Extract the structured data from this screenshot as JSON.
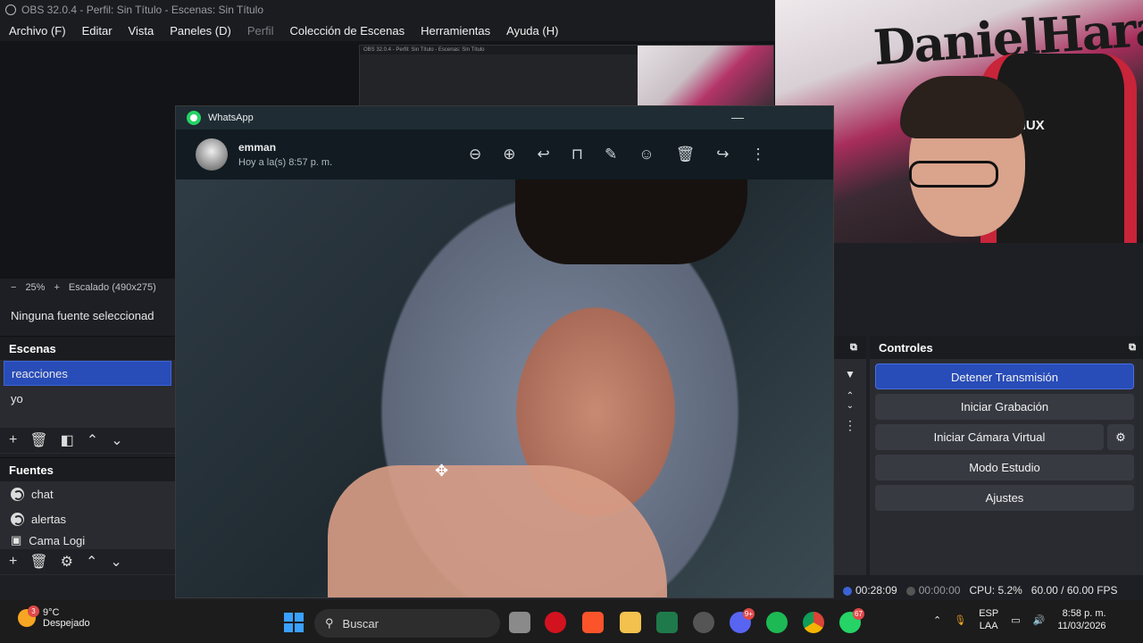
{
  "obs": {
    "title": "OBS 32.0.4 - Perfil: Sin Título - Escenas: Sin Título",
    "menu": [
      "Archivo (F)",
      "Editar",
      "Vista",
      "Paneles (D)",
      "Perfil",
      "Colección de Escenas",
      "Herramientas",
      "Ayuda (H)"
    ],
    "zoom": {
      "minus": "−",
      "value": "25%",
      "plus": "+",
      "scaling": "Escalado (490x275)"
    },
    "no_source": "Ninguna fuente seleccionad",
    "scenes": {
      "title": "Escenas",
      "items": [
        "reacciones",
        "yo"
      ],
      "active_index": 0
    },
    "sources": {
      "title": "Fuentes",
      "items": [
        "chat",
        "alertas",
        "Cama Logi"
      ]
    },
    "controls": {
      "title": "Controles",
      "buttons": [
        "Detener Transmisión",
        "Iniciar Grabación",
        "Iniciar Cámara Virtual",
        "Modo Estudio",
        "Ajustes"
      ]
    },
    "status": {
      "stream_time": "00:28:09",
      "record_time": "00:00:00",
      "cpu": "CPU: 5.2%",
      "fps": "60.00 / 60.00 FPS"
    },
    "mini_preview_text": "OBS 32.0.4 - Perfil: Sin Título - Escenas: Sin Título"
  },
  "webcam": {
    "graffiti_text": "DanielHara",
    "chair_text": "NUX"
  },
  "whatsapp": {
    "window_title": "WhatsApp",
    "contact_name": "emman",
    "timestamp": "Hoy a la(s) 8:57 p. m.",
    "tool_icons": [
      "zoom-out",
      "zoom-in",
      "reply",
      "bookmark",
      "pin",
      "emoji",
      "delete",
      "forward",
      "more"
    ]
  },
  "taskbar": {
    "weather_temp": "9°C",
    "weather_desc": "Despejado",
    "weather_badge": "3",
    "search_placeholder": "Buscar",
    "discord_badge": "9+",
    "whatsapp_badge": "67",
    "lang_top": "ESP",
    "lang_bottom": "LAA",
    "time": "8:58 p. m.",
    "date": "11/03/2026"
  },
  "colors": {
    "accent": "#284cb8",
    "whatsapp": "#25d366",
    "taskbar": "#1c1c1c"
  }
}
